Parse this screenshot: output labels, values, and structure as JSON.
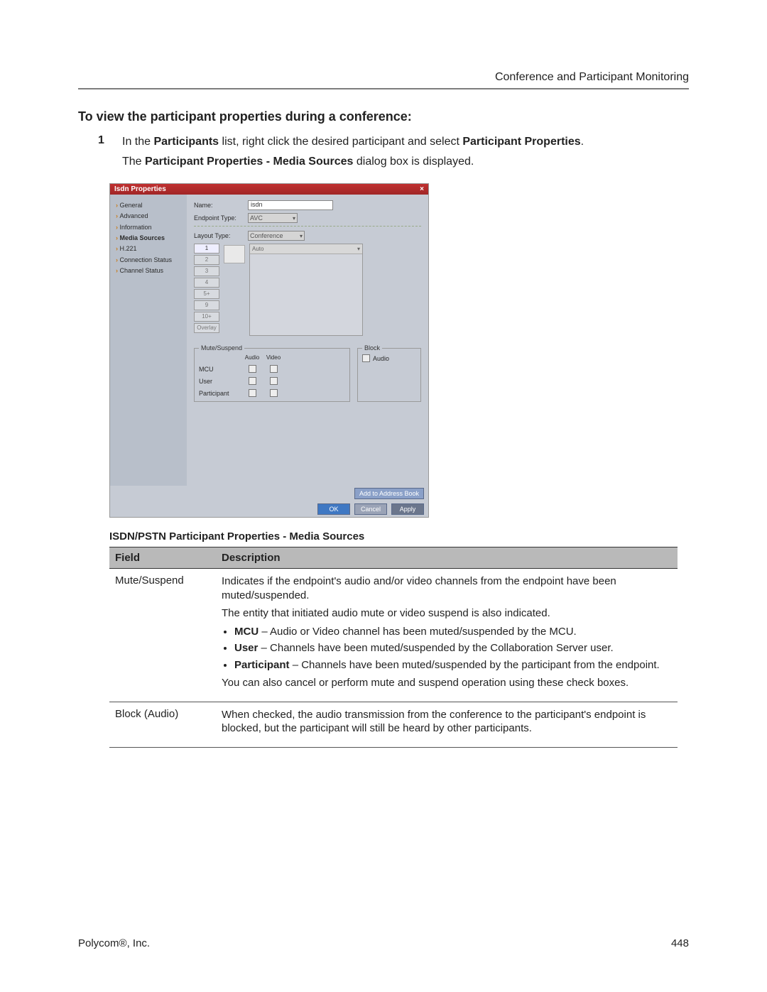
{
  "header": {
    "section": "Conference and Participant Monitoring"
  },
  "heading": "To view the participant properties during a conference:",
  "step": {
    "num": "1",
    "line1_a": "In the ",
    "line1_b": "Participants",
    "line1_c": " list, right click the desired participant and select ",
    "line1_d": "Participant Properties",
    "line1_e": ".",
    "line2_a": "The ",
    "line2_b": "Participant Properties - Media Sources",
    "line2_c": " dialog box is displayed."
  },
  "dialog": {
    "title": "Isdn Properties",
    "nav": {
      "items": [
        "General",
        "Advanced",
        "Information",
        "Media Sources",
        "H.221",
        "Connection Status",
        "Channel Status"
      ],
      "active_index": 3
    },
    "fields": {
      "name_label": "Name:",
      "name_value": "isdn",
      "endpoint_label": "Endpoint Type:",
      "endpoint_value": "AVC",
      "layout_label": "Layout Type:",
      "layout_value": "Conference",
      "auto_value": "Auto"
    },
    "slots": [
      "1",
      "2",
      "3",
      "4",
      "5+",
      "9",
      "10+",
      "Overlay"
    ],
    "mute_suspend": {
      "legend": "Mute/Suspend",
      "col_audio": "Audio",
      "col_video": "Video",
      "rows": [
        "MCU",
        "User",
        "Participant"
      ]
    },
    "block": {
      "legend": "Block",
      "audio_label": "Audio"
    },
    "buttons": {
      "add": "Add to Address Book",
      "ok": "OK",
      "cancel": "Cancel",
      "apply": "Apply"
    }
  },
  "table": {
    "caption": "ISDN/PSTN Participant Properties - Media Sources",
    "head_field": "Field",
    "head_desc": "Description",
    "rows": [
      {
        "field": "Mute/Suspend",
        "p1": "Indicates if the endpoint's audio and/or video channels from the endpoint have been muted/suspended.",
        "p2": "The entity that initiated audio mute or video suspend is also indicated.",
        "b1_bold": "MCU",
        "b1_rest": " – Audio or Video channel has been muted/suspended by the MCU.",
        "b2_bold": "User",
        "b2_rest": " – Channels have been muted/suspended by the Collaboration Server user.",
        "b3_bold": "Participant",
        "b3_rest": " – Channels have been muted/suspended by the participant from the endpoint.",
        "p3": "You can also cancel or perform mute and suspend operation using these check boxes."
      },
      {
        "field": "Block (Audio)",
        "p1": "When checked, the audio transmission from the conference to the participant's endpoint is blocked, but the participant will still be heard by other participants."
      }
    ]
  },
  "footer": {
    "company": "Polycom®, Inc.",
    "page": "448"
  }
}
